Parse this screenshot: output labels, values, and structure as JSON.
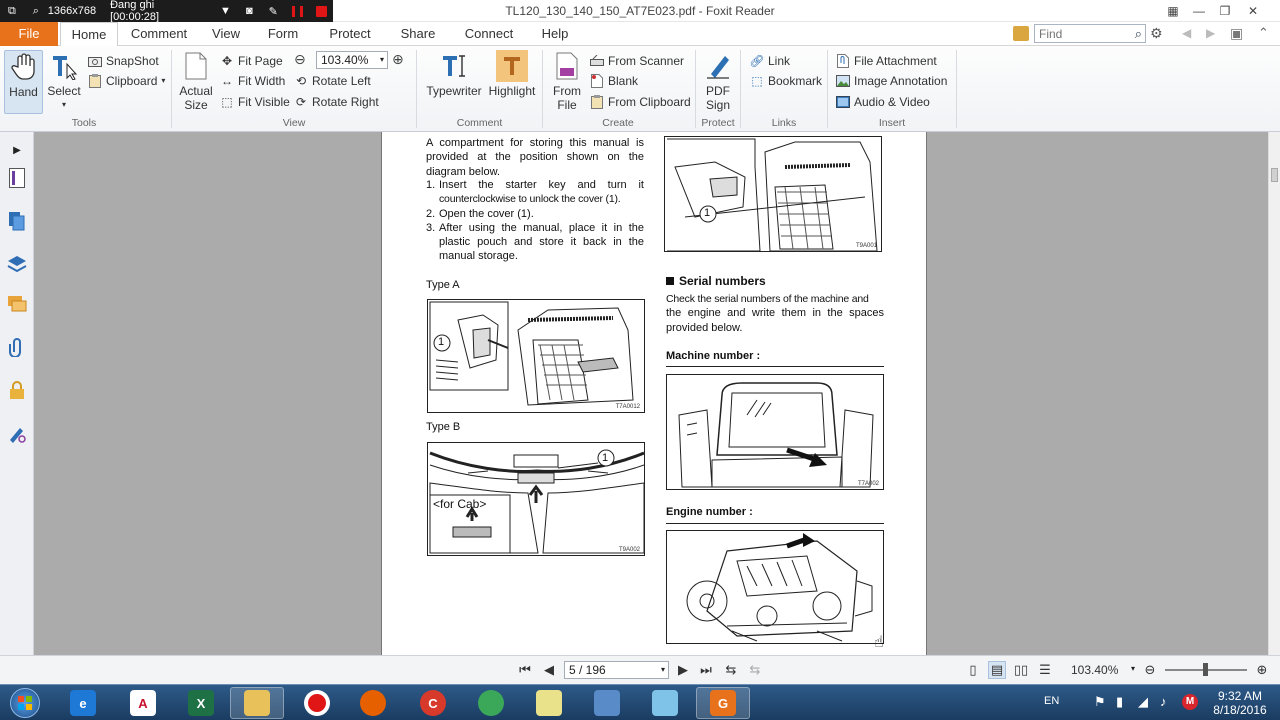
{
  "recorder": {
    "resolution": "1366x768",
    "status": "Đang ghi [00:00:28]"
  },
  "window": {
    "title": "TL120_130_140_150_AT7E023.pdf - Foxit Reader"
  },
  "tabs": [
    "File",
    "Home",
    "Comment",
    "View",
    "Form",
    "Protect",
    "Share",
    "Connect",
    "Help"
  ],
  "find": {
    "placeholder": "Find"
  },
  "ribbon": {
    "tools": {
      "label": "Tools",
      "hand": "Hand",
      "select": "Select",
      "snapshot": "SnapShot",
      "clipboard": "Clipboard"
    },
    "view": {
      "label": "View",
      "actual_size_line1": "Actual",
      "actual_size_line2": "Size",
      "fit_page": "Fit Page",
      "fit_width": "Fit Width",
      "fit_visible": "Fit Visible",
      "zoom": "103.40%",
      "rotate_left": "Rotate Left",
      "rotate_right": "Rotate Right"
    },
    "comment": {
      "label": "Comment",
      "typewriter": "Typewriter",
      "highlight": "Highlight"
    },
    "create": {
      "label": "Create",
      "from_file_line1": "From",
      "from_file_line2": "File",
      "from_scanner": "From Scanner",
      "blank": "Blank",
      "from_clipboard": "From Clipboard"
    },
    "protect": {
      "label": "Protect",
      "pdf_sign_line1": "PDF",
      "pdf_sign_line2": "Sign"
    },
    "links": {
      "label": "Links",
      "link": "Link",
      "bookmark": "Bookmark"
    },
    "insert": {
      "label": "Insert",
      "file_attachment": "File Attachment",
      "image_annotation": "Image Annotation",
      "audio_video": "Audio & Video"
    }
  },
  "document": {
    "intro": "A compartment for storing this manual is provided at the position shown on the diagram below.",
    "steps": [
      {
        "num": "1.",
        "line1": "Insert the starter key and turn it",
        "line2": "counterclockwise to unlock the cover (1)."
      },
      {
        "num": "2.",
        "line1": "Open the cover (1).",
        "line2": ""
      },
      {
        "num": "3.",
        "line1": "After using the manual, place it in the",
        "line2": "plastic pouch and store it back in the",
        "line3": "manual storage."
      }
    ],
    "type_a": "Type A",
    "type_b": "Type B",
    "for_cab": "<for Cab>",
    "callout": "1",
    "fig_codes": {
      "top_right": "T9A001",
      "type_a": "T7A0012",
      "type_b": "T9A002",
      "machine": "T7A002"
    },
    "serial_heading": "Serial numbers",
    "serial_text": [
      "Check the serial numbers of the machine and",
      "the engine and write them in the spaces",
      "provided below."
    ],
    "machine_number": "Machine number :",
    "engine_number": "Engine number :"
  },
  "statusbar": {
    "page": "5 / 196",
    "zoom": "103.40%"
  },
  "taskbar": {
    "language": "EN",
    "time": "9:32 AM",
    "date": "8/18/2016"
  },
  "colors": {
    "file_tab": "#e8711b",
    "ribbon_bg": "#f1f3f6",
    "doc_bg": "#ababab",
    "taskbar": "#1b3c61"
  }
}
